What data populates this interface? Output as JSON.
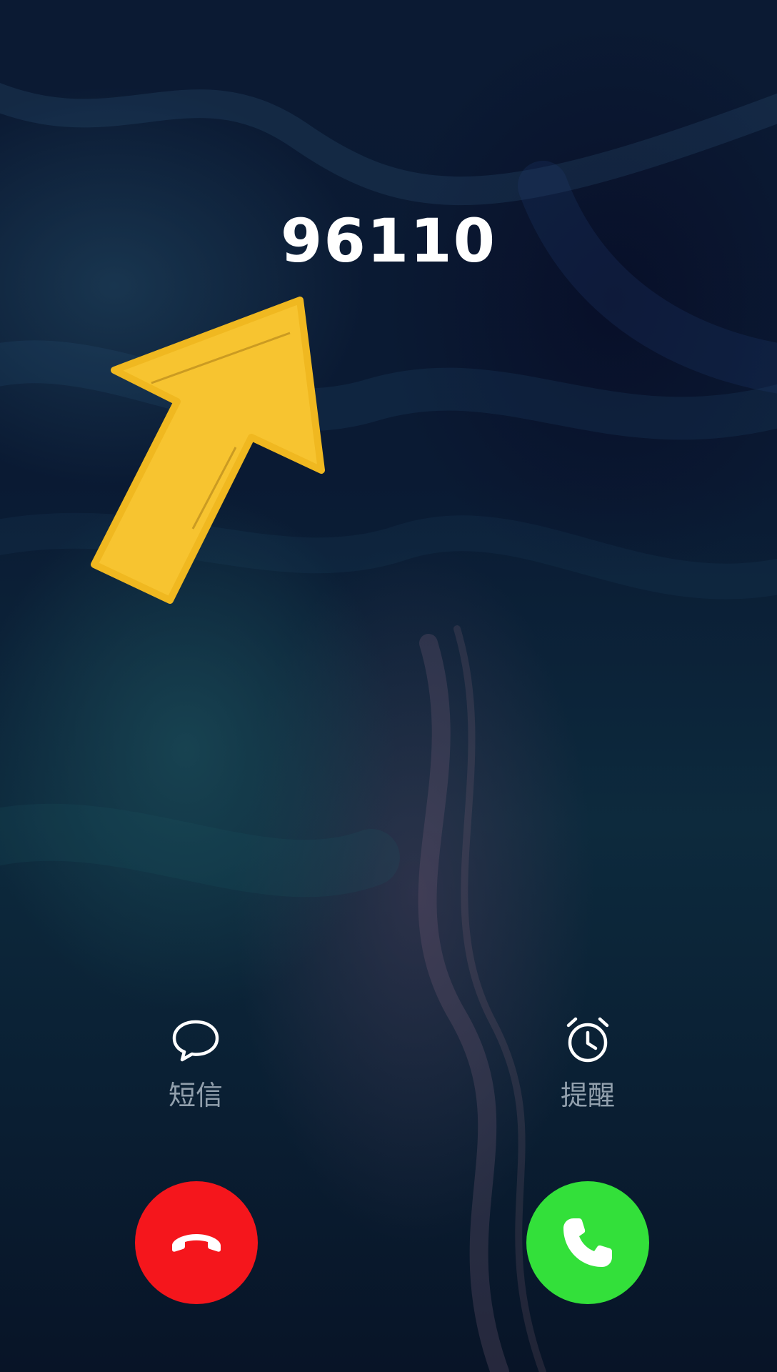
{
  "caller": {
    "number": "96110"
  },
  "quick_actions": {
    "message_label": "短信",
    "remind_label": "提醒"
  },
  "call_controls": {
    "decline_icon": "phone-hangup-icon",
    "accept_icon": "phone-answer-icon",
    "decline_color": "#f5161c",
    "accept_color": "#33e03a"
  },
  "overlay": {
    "arrow_icon": "arrow-up-right-icon",
    "arrow_color": "#f7c430"
  }
}
